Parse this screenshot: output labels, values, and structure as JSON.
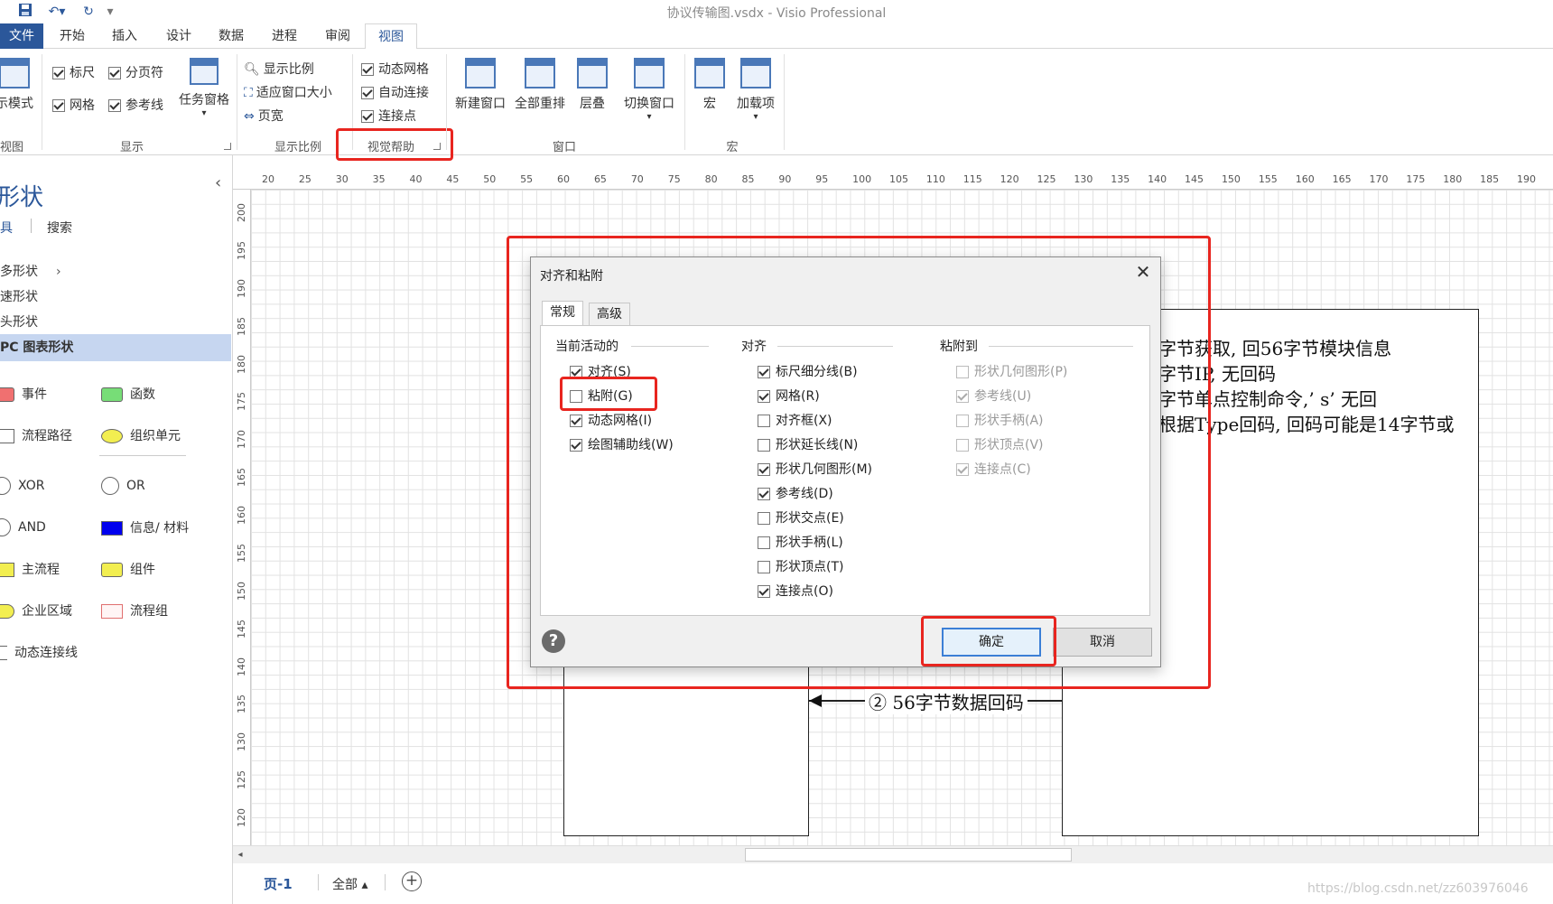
{
  "app": {
    "title": "协议传输图.vsdx - Visio Professional"
  },
  "tabs": [
    "文件",
    "开始",
    "插入",
    "设计",
    "数据",
    "进程",
    "审阅",
    "视图"
  ],
  "ribbon": {
    "view_mode_label": "示模式",
    "view_group": "视图",
    "show_group": {
      "label": "显示",
      "items": [
        "标尺",
        "分页符",
        "网格",
        "参考线"
      ],
      "task_pane": "任务窗格"
    },
    "zoom_group": {
      "label": "显示比例",
      "items": [
        "显示比例",
        "适应窗口大小",
        "页宽"
      ]
    },
    "visual_aids_group": {
      "label": "视觉帮助",
      "items": [
        "动态网格",
        "自动连接",
        "连接点"
      ]
    },
    "window_group": {
      "label": "窗口",
      "buttons": [
        "新建窗口",
        "全部重排",
        "层叠",
        "切换窗口"
      ]
    },
    "macro_group": {
      "label": "宏",
      "buttons": [
        "宏",
        "加载项"
      ]
    }
  },
  "shapes_pane": {
    "title": "形状",
    "tabs": [
      "具",
      "搜索"
    ],
    "categories": [
      "多形状",
      "速形状",
      "头形状",
      "PC 图表形状"
    ],
    "items": [
      [
        "事件",
        "函数"
      ],
      [
        "流程路径",
        "组织单元"
      ],
      [
        "XOR",
        "OR"
      ],
      [
        "AND",
        "信息/ 材料"
      ],
      [
        "主流程",
        "组件"
      ],
      [
        "企业区域",
        "流程组"
      ],
      [
        "动态连接线"
      ]
    ],
    "collapse_glyph": "‹"
  },
  "ruler": {
    "h": [
      "20",
      "25",
      "30",
      "35",
      "40",
      "45",
      "50",
      "55",
      "60",
      "65",
      "70",
      "75",
      "80",
      "85",
      "90",
      "95",
      "100",
      "105",
      "110",
      "115",
      "120",
      "125",
      "130",
      "135",
      "140",
      "145",
      "150",
      "155",
      "160",
      "165",
      "170",
      "175",
      "180",
      "185",
      "190"
    ],
    "v": [
      "200",
      "195",
      "190",
      "185",
      "180",
      "175",
      "170",
      "165",
      "160",
      "155",
      "150",
      "145",
      "140",
      "135",
      "130",
      "125",
      "120"
    ]
  },
  "diagram": {
    "lines": [
      "字节获取, 回56字节模块信息",
      "字节IP, 无回码",
      "字节单点控制命令,’ s’ 无回",
      "根据Type回码, 回码可能是14字节或"
    ],
    "arrow_label": "② 56字节数据回码"
  },
  "dialog": {
    "title": "对齐和粘附",
    "close": "✕",
    "tabs": [
      "常规",
      "高级"
    ],
    "sections": {
      "active": {
        "title": "当前活动的",
        "options": [
          {
            "label": "对齐(S)",
            "checked": true
          },
          {
            "label": "粘附(G)",
            "checked": false
          },
          {
            "label": "动态网格(I)",
            "checked": true
          },
          {
            "label": "绘图辅助线(W)",
            "checked": true
          }
        ]
      },
      "snap_to": {
        "title": "对齐",
        "options": [
          {
            "label": "标尺细分线(B)",
            "checked": true
          },
          {
            "label": "网格(R)",
            "checked": true
          },
          {
            "label": "对齐框(X)",
            "checked": false
          },
          {
            "label": "形状延长线(N)",
            "checked": false
          },
          {
            "label": "形状几何图形(M)",
            "checked": true
          },
          {
            "label": "参考线(D)",
            "checked": true
          },
          {
            "label": "形状交点(E)",
            "checked": false
          },
          {
            "label": "形状手柄(L)",
            "checked": false
          },
          {
            "label": "形状顶点(T)",
            "checked": false
          },
          {
            "label": "连接点(O)",
            "checked": true
          }
        ]
      },
      "glue_to": {
        "title": "粘附到",
        "options": [
          {
            "label": "形状几何图形(P)",
            "checked": false
          },
          {
            "label": "参考线(U)",
            "checked": true
          },
          {
            "label": "形状手柄(A)",
            "checked": false
          },
          {
            "label": "形状顶点(V)",
            "checked": false
          },
          {
            "label": "连接点(C)",
            "checked": true
          }
        ]
      }
    },
    "help": "?",
    "ok": "确定",
    "cancel": "取消"
  },
  "statusbar": {
    "page_tab": "页-1",
    "all": "全部 ▴",
    "add": "+"
  },
  "watermark": "https://blog.csdn.net/zz603976046",
  "colors": {
    "accent": "#2b579a",
    "highlight": "#e8251f"
  }
}
